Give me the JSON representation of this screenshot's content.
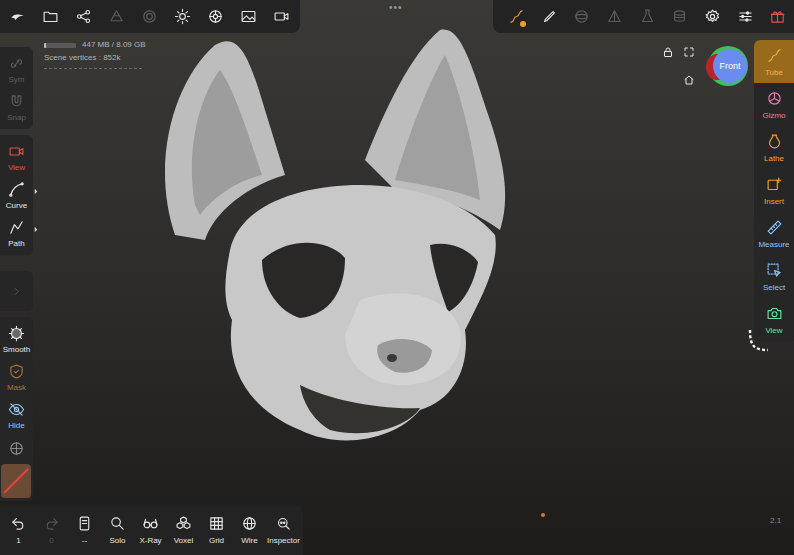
{
  "top_menu": {
    "label": "•••"
  },
  "top_left_tools": [
    {
      "kind": "logo",
      "disabled": false
    },
    {
      "kind": "folder",
      "disabled": false
    },
    {
      "kind": "share",
      "disabled": false
    },
    {
      "kind": "layers",
      "disabled": true
    },
    {
      "kind": "circle",
      "disabled": true
    },
    {
      "kind": "sun",
      "disabled": false
    },
    {
      "kind": "wheel",
      "disabled": false
    },
    {
      "kind": "image",
      "disabled": false
    },
    {
      "kind": "video",
      "disabled": false
    }
  ],
  "top_right_tools": [
    {
      "kind": "tube",
      "selected": true,
      "color": "#f0a030"
    },
    {
      "kind": "brush",
      "selected": false,
      "color": "#e6e6e6"
    },
    {
      "kind": "sphere",
      "selected": false,
      "color": "#5c5c5c"
    },
    {
      "kind": "triangle",
      "selected": false,
      "color": "#5c5c5c"
    },
    {
      "kind": "flask",
      "selected": false,
      "color": "#5c5c5c"
    },
    {
      "kind": "stack",
      "selected": false,
      "color": "#5c5c5c"
    },
    {
      "kind": "gear",
      "selected": false,
      "color": "#e6e6e6"
    },
    {
      "kind": "sliders",
      "selected": false,
      "color": "#e6e6e6"
    },
    {
      "kind": "gift",
      "selected": false,
      "color": "#d9534f"
    }
  ],
  "stats": {
    "memory": "447 MB / 8.09 GB",
    "memory_level": 0.06,
    "vertices": "Scene vertices : 852k"
  },
  "left_groups": [
    {
      "items": [
        {
          "label": "Sym",
          "kind": "sym",
          "color": "#5e5e5e",
          "expandable": false
        },
        {
          "label": "Snap",
          "kind": "snap",
          "color": "#5e5e5e",
          "expandable": false
        }
      ]
    },
    {
      "items": [
        {
          "label": "View",
          "kind": "camera",
          "color": "#e0533f",
          "expandable": false
        },
        {
          "label": "Curve",
          "kind": "curve",
          "color": "#e8e8e8",
          "expandable": true
        },
        {
          "label": "Path",
          "kind": "path",
          "color": "#e8e8e8",
          "expandable": true
        }
      ]
    },
    {
      "items": []
    },
    {
      "items": [
        {
          "label": "Smooth",
          "kind": "smooth",
          "color": "#e8e8e8",
          "expandable": false
        },
        {
          "label": "Mask",
          "kind": "mask",
          "color": "#a8743a",
          "expandable": false
        },
        {
          "label": "Hide",
          "kind": "hide",
          "color": "#9cc4ee",
          "expandable": false
        },
        {
          "kind": "target",
          "color": "#8a8a8a",
          "expandable": false
        }
      ]
    }
  ],
  "material": {
    "color": "#6b4a36",
    "empty": true
  },
  "right_tools": [
    {
      "label": "Tube",
      "kind": "tube",
      "color": "#f5b342",
      "selected": true
    },
    {
      "label": "Gizmo",
      "kind": "gizmo",
      "color": "#e77fb0",
      "selected": false
    },
    {
      "label": "Lathe",
      "kind": "lathe",
      "color": "#f0a030",
      "selected": false
    },
    {
      "label": "Insert",
      "kind": "insert",
      "color": "#f0a030",
      "selected": false
    },
    {
      "label": "Measure",
      "kind": "measure",
      "color": "#8ec5ff",
      "selected": false
    },
    {
      "label": "Select",
      "kind": "select",
      "color": "#8ec5ff",
      "selected": false
    },
    {
      "label": "View",
      "kind": "view",
      "color": "#6ee0a0",
      "selected": false
    }
  ],
  "viewport": {
    "orientation": "Front",
    "version": "2.1"
  },
  "bottom_tools": [
    {
      "kind": "undo",
      "label": "1",
      "disabled": false
    },
    {
      "kind": "redo",
      "label": "0",
      "disabled": true
    },
    {
      "kind": "file",
      "label": "--",
      "disabled": false
    },
    {
      "kind": "search",
      "label": "Solo",
      "disabled": false
    },
    {
      "kind": "xray",
      "label": "X-Ray",
      "disabled": false
    },
    {
      "kind": "voxel",
      "label": "Voxel",
      "disabled": false
    },
    {
      "kind": "grid",
      "label": "Grid",
      "disabled": false
    },
    {
      "kind": "wire",
      "label": "Wire",
      "disabled": false
    },
    {
      "kind": "inspector",
      "label": "Inspector",
      "disabled": false
    }
  ]
}
